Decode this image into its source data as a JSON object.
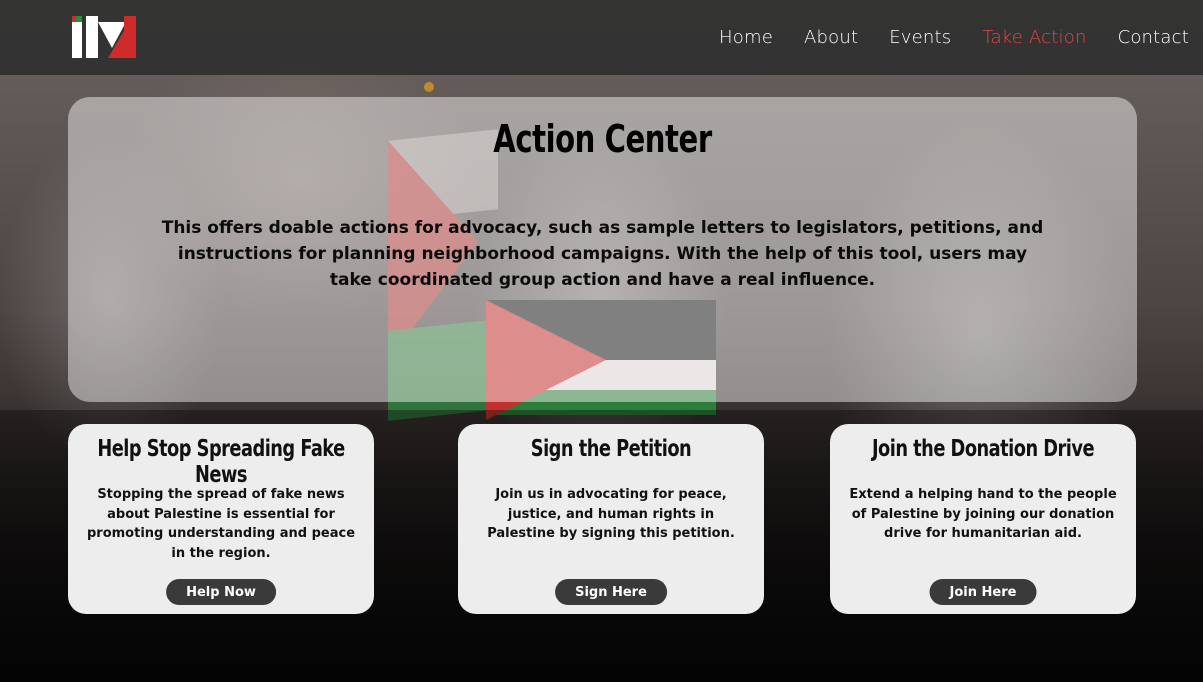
{
  "nav": {
    "logo_text": "IM",
    "items": [
      {
        "label": "Home",
        "active": false
      },
      {
        "label": "About",
        "active": false
      },
      {
        "label": "Events",
        "active": false
      },
      {
        "label": "Take Action",
        "active": true
      },
      {
        "label": "Contact",
        "active": false
      }
    ]
  },
  "hero": {
    "title": "Action Center",
    "description": "This offers doable actions for advocacy, such as sample letters to legislators, petitions, and instructions for planning neighborhood campaigns. With the help of this tool, users may take coordinated group action and have a real influence."
  },
  "cards": [
    {
      "title": "Help Stop Spreading Fake News",
      "body": "Stopping the spread of fake news about Palestine is essential for promoting understanding and peace in the region.",
      "button": "Help Now"
    },
    {
      "title": "Sign the Petition",
      "body": "Join us in advocating for peace, justice, and human rights in Palestine by signing this petition.",
      "button": "Sign Here"
    },
    {
      "title": "Join the Donation Drive",
      "body": "Extend a helping hand to the people of Palestine by joining our donation drive for humanitarian aid.",
      "button": "Join Here"
    }
  ],
  "colors": {
    "navbar_bg": "#303030",
    "active_nav": "#e8473f",
    "card_bg": "#eeeded",
    "button_bg": "#3b3a3a",
    "logo_red": "#cf2b2b",
    "logo_green": "#2e8b3a"
  }
}
